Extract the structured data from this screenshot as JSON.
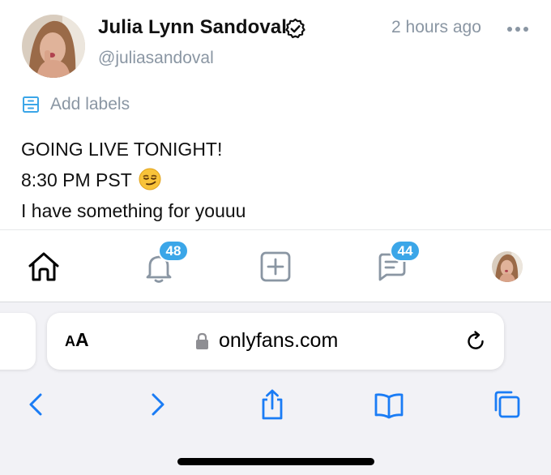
{
  "post": {
    "author": {
      "display_name": "Julia Lynn Sandoval",
      "username": "@juliasandoval",
      "verified": true
    },
    "timestamp": "2 hours ago",
    "labels_action": "Add labels",
    "text_lines": [
      "GOING LIVE TONIGHT!",
      "8:30 PM PST",
      "I have something for youuu"
    ],
    "emoji": "smirking-face"
  },
  "bottom_nav": {
    "items": [
      {
        "name": "home",
        "icon": "home-icon"
      },
      {
        "name": "notifications",
        "icon": "bell-icon",
        "badge": "48"
      },
      {
        "name": "new-post",
        "icon": "plus-square-icon"
      },
      {
        "name": "messages",
        "icon": "message-icon",
        "badge": "44"
      },
      {
        "name": "profile",
        "icon": "avatar"
      }
    ]
  },
  "browser": {
    "text_size_button": {
      "small": "A",
      "large": "A"
    },
    "url": "onlyfans.com",
    "toolbar": [
      "back-icon",
      "forward-icon",
      "share-icon",
      "bookmarks-icon",
      "tabs-icon"
    ]
  },
  "colors": {
    "accent": "#3ba6e8",
    "icon_grey": "#8a96a3",
    "safari_blue": "#1a7cf5",
    "text": "#111111"
  }
}
